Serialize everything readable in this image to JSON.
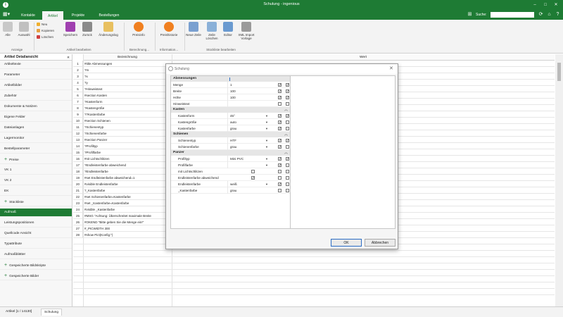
{
  "app": {
    "title": "Schulung - ingenious",
    "logo": "i",
    "window_controls": [
      "–",
      "□",
      "✕"
    ]
  },
  "menu": {
    "tabs": [
      "Kontakte",
      "Artikel",
      "Projekte",
      "Bestellungen"
    ],
    "active_tab": "Artikel",
    "search_label": "Suche:",
    "search_value": ""
  },
  "ribbon": {
    "anzeige": {
      "label": "Anzeige",
      "alle": "Alle",
      "auswahl": "Auswahl"
    },
    "bearbeiten": {
      "label": "Artikel bearbeiten",
      "neu": "Neu",
      "kopieren": "Kopieren",
      "loeschen": "Löschen",
      "speichern": "Speichern",
      "zurueck": "Zurück",
      "aenderungslog": "Änderungslog"
    },
    "berechnung": {
      "label": "Berechnung...",
      "preisinfo": "Preisinfo"
    },
    "information": {
      "label": "Information...",
      "preishistorie": "Preishistorie"
    },
    "stueckliste": {
      "label": "Stückliste bearbeiten",
      "neue_zeile": "Neue Zeile",
      "zeile_loeschen": "Zeile Löschen",
      "editor": "Editor",
      "xml_import": "XML Import Vorlage"
    }
  },
  "sidebar": {
    "header": "Artikel Detailansicht",
    "collapse": "«",
    "items": [
      {
        "label": "Artikeltexte",
        "plus": false
      },
      {
        "label": "Parameter",
        "plus": false
      },
      {
        "label": "Artikelbilder",
        "plus": false
      },
      {
        "label": "Zubehör",
        "plus": false
      },
      {
        "label": "Dokumente & Notizen",
        "plus": false
      },
      {
        "label": "Eigene Felder",
        "plus": false
      },
      {
        "label": "Dateianlagen",
        "plus": false
      },
      {
        "label": "Lagermonitor",
        "plus": false
      },
      {
        "label": "Bestellparameter",
        "plus": false
      },
      {
        "label": "Preise",
        "plus": true
      },
      {
        "label": "VK 1",
        "plus": false
      },
      {
        "label": "VK 2",
        "plus": false
      },
      {
        "label": "EK",
        "plus": false
      },
      {
        "label": "Stückliste",
        "plus": true
      },
      {
        "label": "Aufmaß",
        "plus": false,
        "active": true
      },
      {
        "label": "Leistungspositionen",
        "plus": false
      },
      {
        "label": "Quellcode Ansicht",
        "plus": false
      },
      {
        "label": "Typattribute",
        "plus": false
      },
      {
        "label": "Aufmaßblätter",
        "plus": false
      },
      {
        "label": "Gespeicherte Bildskripte",
        "plus": true
      },
      {
        "label": "Gespeicherte Bilder",
        "plus": true
      }
    ]
  },
  "table": {
    "col_bezeichnung": "Bezeichnung",
    "col_wert": "Wert",
    "rows": [
      "#title Abmessungen",
      "?m",
      "?x",
      "?y",
      "?Hinweistext",
      "#section Kasten",
      "?Kastenform",
      "?Kastengröße",
      "??Kastenfarbe",
      "#section Schienen",
      "?Schienentyp",
      "?Schienenfarbe",
      "#section Panzer",
      "?Profiltyp",
      "?Profilfarbe",
      "#nit Lichtschlitzen",
      "?Endleistenfarbe abweichend",
      "?Endleistenfarbe",
      "#set Endleistenfarbe abweichend=1",
      "#visible Endleistenfarbe",
      "?_Kastenfarbe",
      "#set Schienenfarbe=Kastenfarbe",
      "#set _Kastenfarbe=Kastenfarbe",
      "#visible _Kastenfarbe",
      "#MSG \"Achtung: Überschreitet maximale Breite",
      "#OKEND \"Bitte geben Sie die Menge ein!\"",
      "#_PICWIDTH 300",
      "#show Pict(Konfig:\")"
    ]
  },
  "dialog": {
    "title": "Schulung",
    "close": "✕",
    "ok": "OK",
    "cancel": "Abbrechen",
    "sections": {
      "abmessungen": "Abmessungen",
      "kasten": "Kasten",
      "schienen": "Schienen",
      "panzer": "Panzer"
    },
    "fields": {
      "menge": {
        "label": "Menge",
        "value": "1"
      },
      "breite": {
        "label": "Breite",
        "value": "100"
      },
      "hoehe": {
        "label": "Höhe",
        "value": "100"
      },
      "hinweistext": {
        "label": "Hinweistext",
        "value": ""
      },
      "kastenform": {
        "label": "Kastenform",
        "value": "45°"
      },
      "kastengroesse": {
        "label": "Kastengröße",
        "value": "auto"
      },
      "kastenfarbe": {
        "label": "Kastenfarbe",
        "value": "grau"
      },
      "schienentyp": {
        "label": "Schienentyp",
        "value": "HTF"
      },
      "schienenfarbe": {
        "label": "Schienenfarbe",
        "value": "grau"
      },
      "profiltyp": {
        "label": "Profiltyp",
        "value": "Mini PVC"
      },
      "profilfarbe": {
        "label": "Profilfarbe",
        "value": ""
      },
      "lichtschlitzen": {
        "label": "mit Lichtschlitzen",
        "value": ""
      },
      "endleiste_abw": {
        "label": "Endleistenfarbe abweichend",
        "value": ""
      },
      "endleistenfarbe": {
        "label": "Endleistenfarbe",
        "value": "weiß"
      },
      "kastenfarbe2": {
        "label": "_Kastenfarbe",
        "value": "grau"
      }
    }
  },
  "status": {
    "left": "Artikel [1 / 14130]",
    "tab": "Schulung"
  },
  "colors": {
    "brand": "#1e7b34"
  }
}
